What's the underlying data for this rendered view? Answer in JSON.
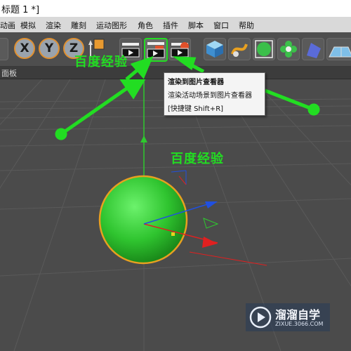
{
  "window": {
    "title": "标题 1 *]"
  },
  "menu": [
    "动画",
    "模拟",
    "渲染",
    "雕刻",
    "运动图形",
    "角色",
    "插件",
    "脚本",
    "窗口",
    "帮助"
  ],
  "toolbar": {
    "axis_labels": [
      "X",
      "Y",
      "Z"
    ],
    "icons": [
      "render-view-icon",
      "render-picture-viewer-icon",
      "edit-render-settings-icon",
      "cube-icon",
      "pen-spline-icon",
      "subdivision-icon",
      "cloner-icon",
      "deformer-icon",
      "floor-icon"
    ]
  },
  "panel": {
    "title": "面板"
  },
  "tooltip": {
    "line1": "渲染到图片查看器",
    "line2": "渲染活动场景到图片查看器",
    "line3": "[快捷键 Shift+R]"
  },
  "watermark": {
    "top_text": "百度经验",
    "center_text": "百度经验",
    "logo_text": "溜溜自学",
    "logo_url": "ZIXUE.3066.COM"
  },
  "colors": {
    "annotation": "#22dd22",
    "sphere": "#33cc22",
    "selection": "#e8a020"
  }
}
